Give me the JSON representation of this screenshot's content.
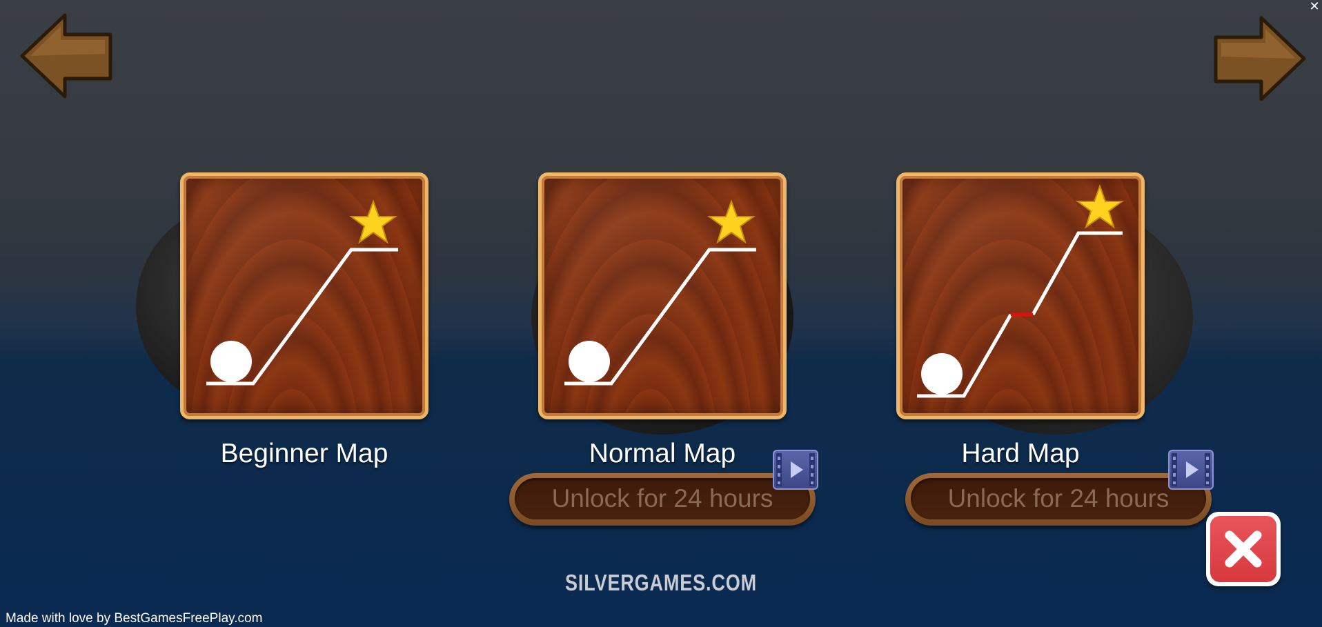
{
  "navigation": {
    "prev_icon": "arrow-left-icon",
    "next_icon": "arrow-right-icon",
    "window_close_icon": "close-icon",
    "window_close_glyph": "✕"
  },
  "maps": [
    {
      "title": "Beginner Map",
      "locked": false,
      "goal_icon": "star-icon",
      "has_gap": false
    },
    {
      "title": "Normal Map",
      "locked": true,
      "unlock_label": "Unlock for 24 hours",
      "unlock_icon": "video-icon",
      "goal_icon": "star-icon",
      "has_gap": false
    },
    {
      "title": "Hard Map",
      "locked": true,
      "unlock_label": "Unlock for 24 hours",
      "unlock_icon": "video-icon",
      "goal_icon": "star-icon",
      "has_gap": true,
      "gap_color": "#e01010"
    }
  ],
  "close_button": {
    "icon": "close-icon"
  },
  "footer": {
    "brand": "SILVERGAMES.COM",
    "credit": "Made with love by BestGamesFreePlay.com"
  },
  "colors": {
    "wood": "#7c2f12",
    "frame": "#f0b667",
    "star": "#ffd21f",
    "close_red": "#d7393e",
    "video_blue": "#4a55a0"
  }
}
